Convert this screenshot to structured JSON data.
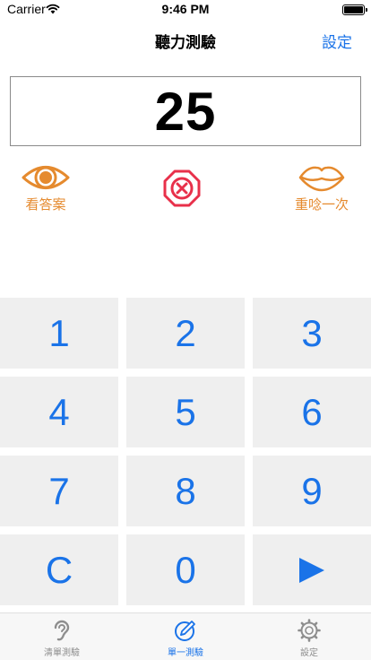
{
  "status_bar": {
    "carrier": "Carrier",
    "time": "9:46 PM",
    "battery_level": 1.0
  },
  "nav": {
    "title": "聽力測驗",
    "settings_label": "設定"
  },
  "display": {
    "number": "25"
  },
  "actions": {
    "show_answer": {
      "label": "看答案",
      "icon": "eye-icon"
    },
    "clear": {
      "icon": "stop-x-icon"
    },
    "replay": {
      "label": "重唸一次",
      "icon": "lips-icon"
    }
  },
  "keypad": {
    "keys": [
      "1",
      "2",
      "3",
      "4",
      "5",
      "6",
      "7",
      "8",
      "9",
      "C",
      "0",
      "play-icon"
    ]
  },
  "tabs": [
    {
      "label": "清單測驗",
      "icon": "ear-icon",
      "active": false
    },
    {
      "label": "單一測驗",
      "icon": "pencil-circle-icon",
      "active": true
    },
    {
      "label": "設定",
      "icon": "gear-icon",
      "active": false
    }
  ],
  "colors": {
    "accent": "#1a73e8",
    "orange": "#e58a2e",
    "red": "#e8304a",
    "key_bg": "#efefef"
  }
}
